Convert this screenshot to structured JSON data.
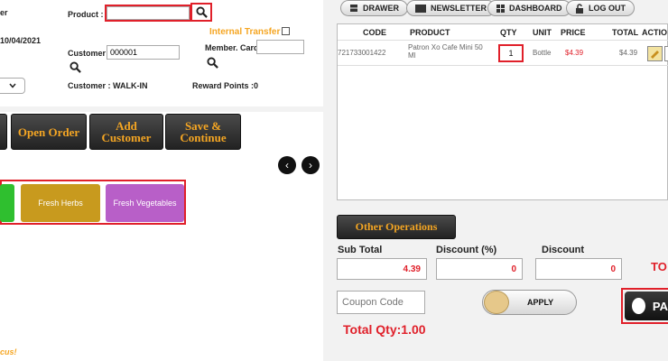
{
  "form": {
    "cut_label": "er",
    "date": "10/04/2021",
    "product_label": "Product :",
    "product_value": "",
    "internal_transfer_label": "Internal Transfer",
    "customer_label": "Customer :",
    "customer_value": "000001",
    "member_card_label": "Member. Card:",
    "member_card_value": "",
    "customer_name": "Customer : WALK-IN",
    "reward_points": "Reward Points :0"
  },
  "action_buttons": {
    "open_order": "Open Order",
    "add_customer": "Add Customer",
    "save_continue": "Save & Continue"
  },
  "nav": {
    "prev": "‹",
    "next": "›"
  },
  "categories": [
    {
      "label": "",
      "color": "#2fbf2f"
    },
    {
      "label": "Fresh Herbs",
      "color": "#c89a1e"
    },
    {
      "label": "Fresh Vegetables",
      "color": "#b85fc8"
    }
  ],
  "footer_text": "cus!",
  "top_menu": {
    "drawer": "DRAWER",
    "newsletter": "NEWSLETTER",
    "dashboard": "DASHBOARD",
    "logout": "LOG OUT"
  },
  "table": {
    "headers": {
      "code": "CODE",
      "product": "PRODUCT",
      "qty": "QTY",
      "unit": "UNIT",
      "price": "PRICE",
      "total": "TOTAL",
      "action": "ACTIO"
    },
    "row": {
      "code": "721733001422",
      "product": "Patron Xo Cafe Mini 50 Ml",
      "qty": "1",
      "unit": "Bottle",
      "price": "$4.39",
      "total": "$4.39"
    }
  },
  "other_operations": "Other Operations",
  "totals": {
    "sub_total_label": "Sub Total",
    "sub_total_value": "4.39",
    "discount_pct_label": "Discount (%)",
    "discount_pct_value": "0",
    "discount_label": "Discount",
    "discount_value": "0",
    "total_label_cut": "TO",
    "coupon_placeholder": "Coupon Code",
    "apply": "APPLY",
    "total_qty": "Total Qty:1.00",
    "pay_cut": "PA"
  },
  "colors": {
    "accent_orange": "#f5a623",
    "red": "#e0202a"
  }
}
